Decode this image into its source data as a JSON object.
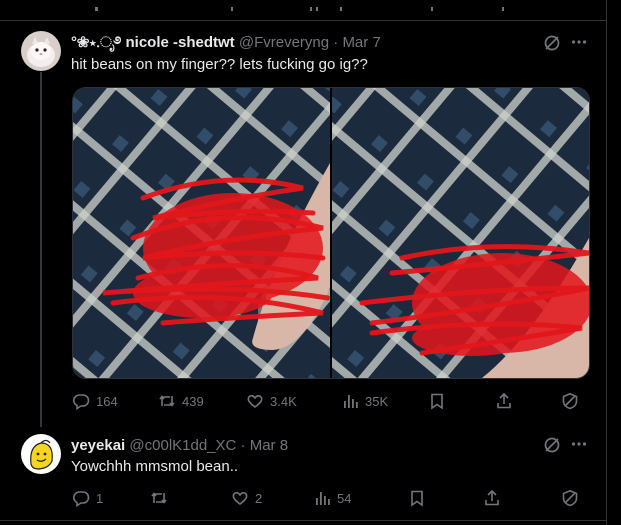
{
  "tweets": [
    {
      "display_name": "°❀⋆.ೃ࿔ nicole -shedtwt",
      "handle": "@Fvreveryng",
      "date": "Mar 7",
      "text": "hit beans on my finger?? lets fucking go ig??",
      "actions": {
        "replies": "164",
        "retweets": "439",
        "likes": "3.4K",
        "views": "35K"
      }
    },
    {
      "display_name": "yeyekai",
      "handle": "@c00lK1dd_XC",
      "date": "Mar 8",
      "text": "Yowchhh mmsmol bean..",
      "actions": {
        "replies": "1",
        "retweets": "",
        "likes": "2",
        "views": "54"
      }
    }
  ],
  "separator": "·",
  "colors": {
    "background": "#000000",
    "text": "#e7e9ea",
    "muted": "#71767b",
    "divider": "#2f3336",
    "scribble": "#e3161b",
    "fabric_dark": "#1b2a3d",
    "fabric_light": "#cfd2cc",
    "finger": "#d9b7a8"
  },
  "icons": [
    "reply-icon",
    "retweet-icon",
    "like-icon",
    "views-icon",
    "bookmark-icon",
    "share-icon",
    "grok-icon",
    "more-icon",
    "shield-icon"
  ]
}
